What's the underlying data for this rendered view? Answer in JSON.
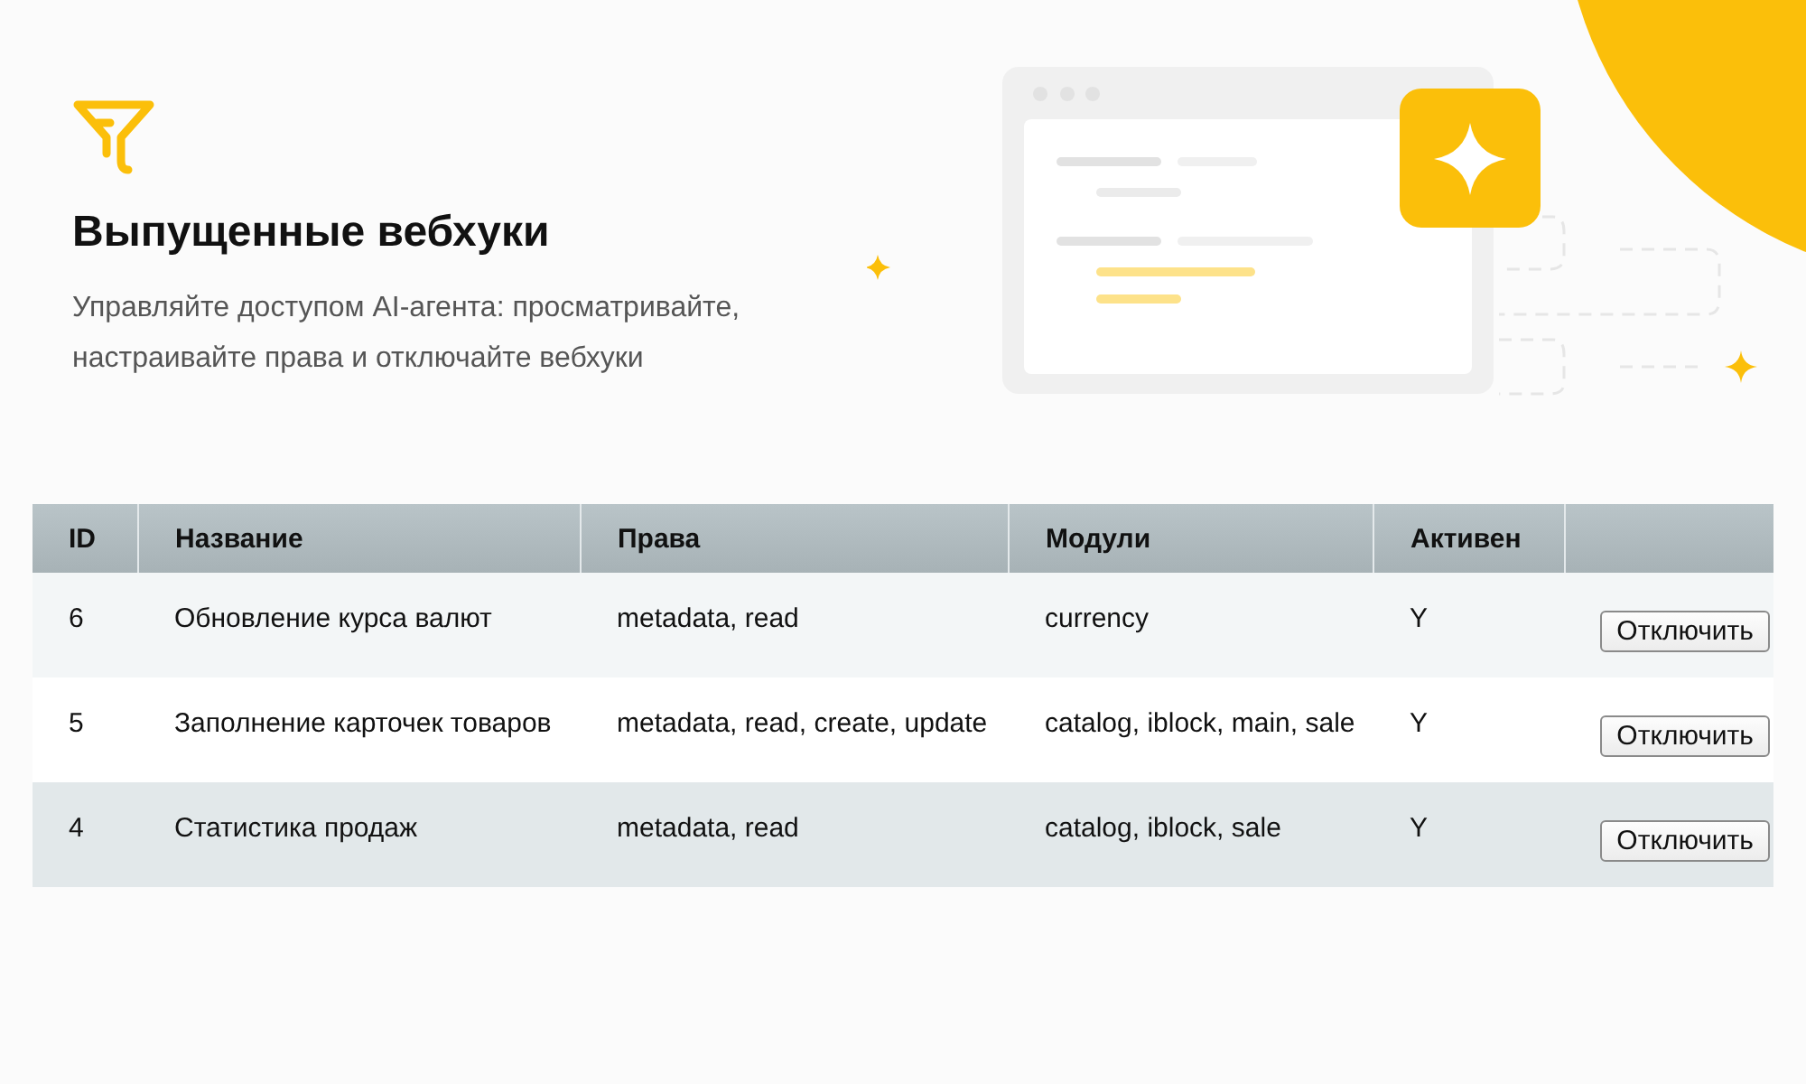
{
  "header": {
    "title": "Выпущенные вебхуки",
    "subtitle": "Управляйте доступом AI-агента: просматривайте, настраивайте права и отключайте вебхуки"
  },
  "table": {
    "columns": [
      "ID",
      "Название",
      "Права",
      "Модули",
      "Активен"
    ],
    "rows": [
      {
        "id": "6",
        "name": "Обновление курса валют",
        "rights": "metadata, read",
        "modules": "currency",
        "active": "Y",
        "action": "Отключить",
        "hovered": false
      },
      {
        "id": "5",
        "name": "Заполнение карточек товаров",
        "rights": "metadata, read, create, update",
        "modules": "catalog, iblock, main, sale",
        "active": "Y",
        "action": "Отключить",
        "hovered": false
      },
      {
        "id": "4",
        "name": "Статистика продаж",
        "rights": "metadata, read",
        "modules": "catalog, iblock, sale",
        "active": "Y",
        "action": "Отключить",
        "hovered": true
      }
    ]
  }
}
